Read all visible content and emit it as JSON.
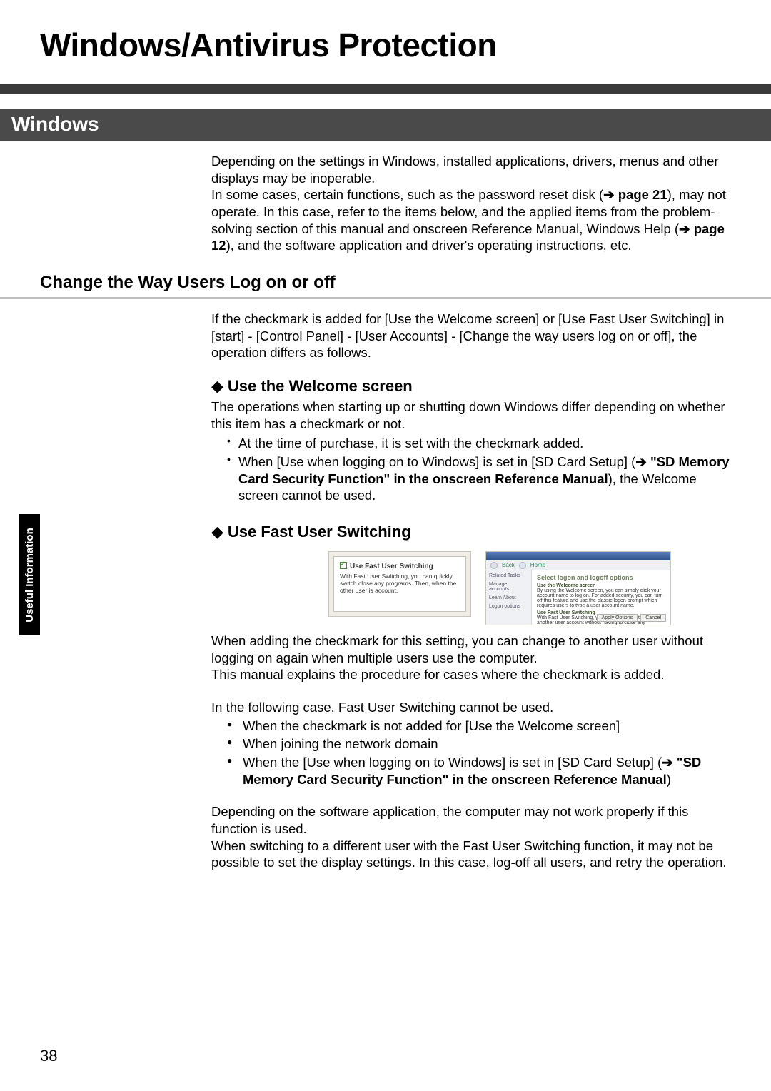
{
  "page_number": "38",
  "side_tab": "Useful Information",
  "title": "Windows/Antivirus Protection",
  "section_band": "Windows",
  "intro": {
    "p1": "Depending on the settings in Windows, installed applications, drivers, menus and other displays may be inoperable.",
    "p2a": "In some cases, certain functions, such as the password reset disk (",
    "p2_ref": "➔ page 21",
    "p2b": "), may not operate. In this case, refer to the items below, and the applied items from the problem-solving section of this manual and onscreen Reference Manual, Windows Help (",
    "p2_ref2": "➔ page 12",
    "p2c": "), and the software application and driver's operating instructions, etc."
  },
  "subhead1": "Change the Way Users Log on or off",
  "change_intro": "If the checkmark is added for [Use the Welcome screen] or [Use Fast User Switching] in [start] - [Control Panel] - [User Accounts] - [Change the way users log on or off], the operation differs as follows.",
  "welcome": {
    "title": "Use the Welcome screen",
    "p": "The operations when starting up or shutting down Windows differ depending on whether this item has a checkmark or not.",
    "b1": "At the time of purchase, it is set with the checkmark added.",
    "b2a": "When [Use when logging on to Windows] is set in [SD Card Setup] (",
    "b2_ref": "➔ \"SD Memory Card Security Function\" in the onscreen Reference Manual",
    "b2b": "), the Welcome screen cannot be used."
  },
  "fast": {
    "title": "Use Fast User Switching",
    "shot_a_caption": "Use Fast User Switching",
    "shot_a_desc": "With Fast User Switching, you can quickly switch close any programs. Then, when the other user is account.",
    "shot_b_header": "Select logon and logoff options",
    "shot_b_back": "Back",
    "shot_b_home": "Home",
    "shot_b_side1": "Related Tasks",
    "shot_b_side2": "Manage accounts",
    "shot_b_side3": "Learn About",
    "shot_b_side4": "Logon options",
    "shot_b_opt1_t": "Use the Welcome screen",
    "shot_b_opt1_d": "By using the Welcome screen, you can simply click your account name to log on. For added security, you can turn off this feature and use the classic logon prompt which requires users to type a user account name.",
    "shot_b_opt2_t": "Use Fast User Switching",
    "shot_b_opt2_d": "With Fast User Switching, you can quickly switch to another user account without having to close any programs. Then, when the other user is finished, you can switch back to your own account.",
    "shot_b_btn_apply": "Apply Options",
    "shot_b_btn_cancel": "Cancel",
    "p1": "When adding the checkmark for this setting, you can change to another user without logging on again when multiple users use the computer.",
    "p2": "This manual explains the procedure for cases where the checkmark is added.",
    "p3": "In the following case, Fast User Switching cannot be used.",
    "b1": "When the checkmark is not added for [Use the Welcome screen]",
    "b2": "When joining the network domain",
    "b3a": "When the [Use when logging on to Windows] is set in [SD Card Setup] (",
    "b3_ref": "➔  \"SD Memory Card Security Function\" in the onscreen Reference Manual",
    "b3b": ")",
    "p4": "Depending on the software application, the computer may not work properly if this function is used.",
    "p5": "When switching to a different user with the Fast User Switching function, it may not be possible to set the display settings. In this case, log-off all users, and retry the operation."
  }
}
